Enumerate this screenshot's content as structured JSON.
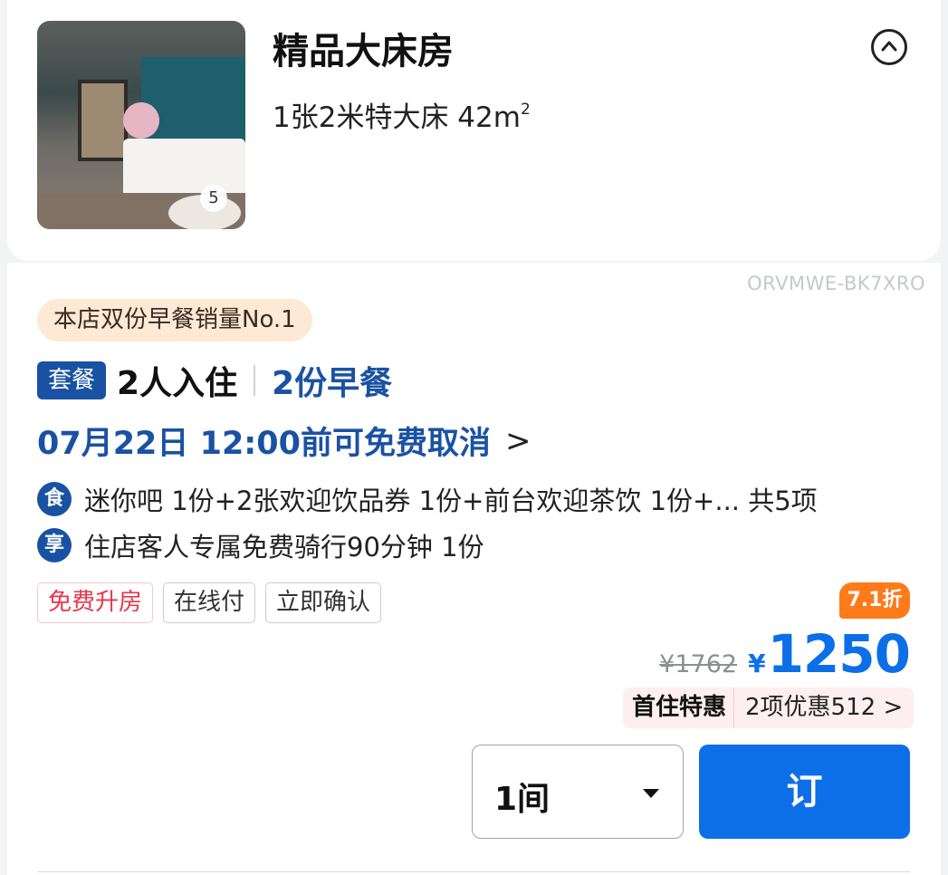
{
  "room": {
    "title": "精品大床房",
    "spec": "1张2米特大床  42m",
    "area_unit_superscript": "2",
    "photo_count": "5"
  },
  "watermark": "ORVMWE-BK7XRO",
  "promo_pill": "本店双份早餐销量No.1",
  "package": {
    "badge": "套餐",
    "guests": "2人入住",
    "breakfast": "2份早餐"
  },
  "cancel": {
    "text": "07月22日 12:00前可免费取消",
    "chevron": ">"
  },
  "perks": [
    {
      "icon_char": "食",
      "icon_name": "food-icon",
      "text": "迷你吧 1份+2张欢迎饮品券 1份+前台欢迎茶饮 1份+... 共5项"
    },
    {
      "icon_char": "享",
      "icon_name": "enjoy-icon",
      "text": "住店客人专属免费骑行90分钟  1份"
    }
  ],
  "tags": [
    "免费升房",
    "在线付",
    "立即确认"
  ],
  "price": {
    "discount": "7.1折",
    "original": "¥1762",
    "currency": "¥",
    "current": "1250"
  },
  "offer": {
    "badge": "首住特惠",
    "detail": "2项优惠512 >"
  },
  "booking": {
    "quantity": "1间",
    "book_label": "订"
  },
  "colors": {
    "accent_blue": "#0d6fe8",
    "brand_navy": "#1a52a3",
    "discount_orange": "#ff7a1a",
    "tag_red": "#e8354a"
  }
}
